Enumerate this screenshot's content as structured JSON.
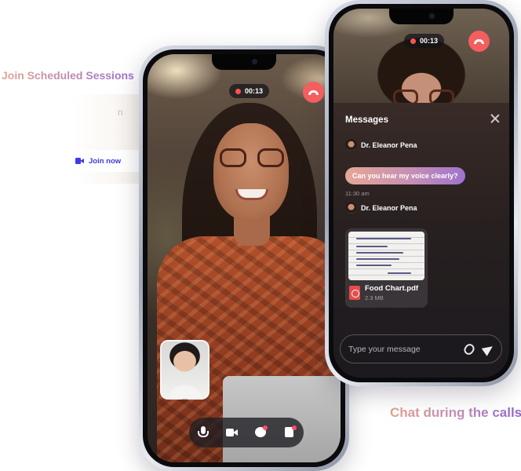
{
  "captions": {
    "join_scheduled": "Join Scheduled Sessions",
    "chat_during_calls": "Chat during the calls"
  },
  "session_card": {
    "join_label": "Join now",
    "faded_text": "n"
  },
  "left_call": {
    "timer": "00:13",
    "controls": [
      "microphone-icon",
      "video-camera-icon",
      "chat-icon",
      "notes-icon"
    ]
  },
  "right_call": {
    "timer": "00:13",
    "chat": {
      "title": "Messages",
      "messages": [
        {
          "sender": "Dr. Eleanor Pena",
          "text": "Can you hear my voice clearly?",
          "time": "11:30 am"
        },
        {
          "sender": "Dr. Eleanor Pena",
          "file": {
            "name": "Food Chart.pdf",
            "size": "2.3 MB"
          }
        }
      ],
      "compose_placeholder": "Type your message"
    }
  },
  "colors": {
    "end_call": "#f45e5e",
    "recording": "#ff5252",
    "join_blue": "#3d3ae6",
    "bubble_start": "#e5a797",
    "bubble_end": "#9e73cd"
  }
}
